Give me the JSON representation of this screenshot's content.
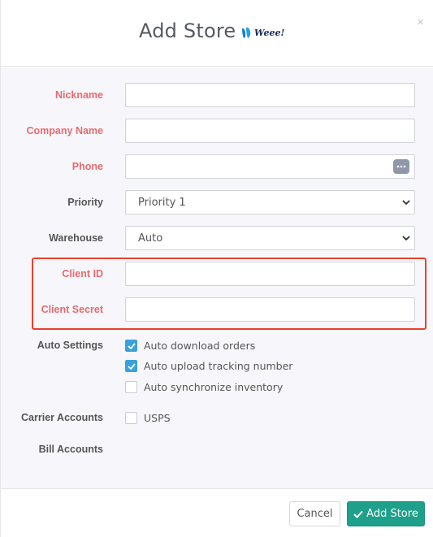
{
  "modal": {
    "title": "Add Store",
    "logo_text": "Weee!",
    "close_glyph": "×"
  },
  "fields": {
    "nickname": {
      "label": "Nickname",
      "value": ""
    },
    "company_name": {
      "label": "Company Name",
      "value": ""
    },
    "phone": {
      "label": "Phone",
      "value": ""
    },
    "priority": {
      "label": "Priority",
      "value": "Priority 1"
    },
    "warehouse": {
      "label": "Warehouse",
      "value": "Auto"
    },
    "client_id": {
      "label": "Client ID",
      "value": ""
    },
    "client_secret": {
      "label": "Client Secret",
      "value": ""
    }
  },
  "auto_settings": {
    "label": "Auto Settings",
    "options": [
      {
        "label": "Auto download orders",
        "checked": true
      },
      {
        "label": "Auto upload tracking number",
        "checked": true
      },
      {
        "label": "Auto synchronize inventory",
        "checked": false
      }
    ]
  },
  "carrier_accounts": {
    "label": "Carrier Accounts",
    "options": [
      {
        "label": "USPS",
        "checked": false
      }
    ]
  },
  "bill_accounts": {
    "label": "Bill Accounts"
  },
  "footer": {
    "cancel_label": "Cancel",
    "add_label": "Add Store"
  },
  "colors": {
    "required_label": "#e86a6f",
    "checkbox_checked": "#3aa1da",
    "primary_button": "#1fa08b",
    "highlight_box": "#e8412c"
  }
}
